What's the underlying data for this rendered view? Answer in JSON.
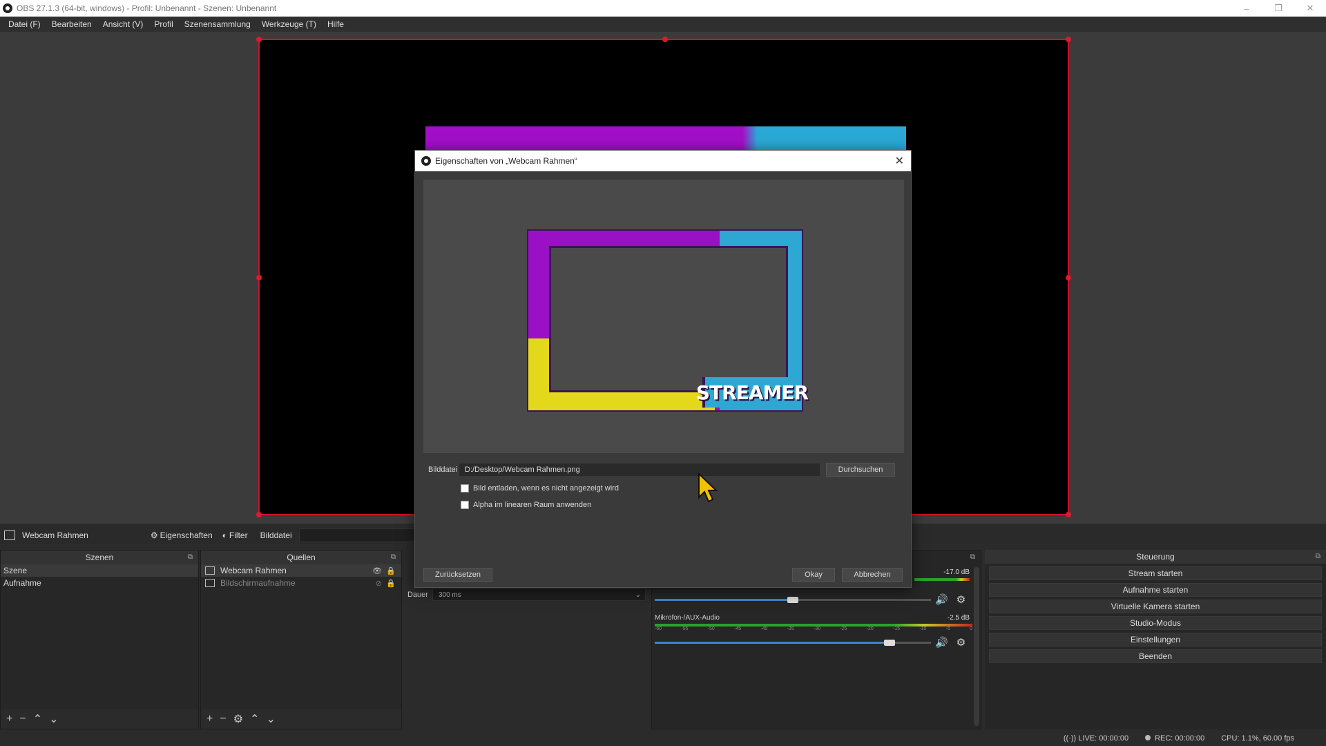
{
  "window": {
    "title": "OBS 27.1.3 (64-bit, windows) - Profil: Unbenannt - Szenen: Unbenannt",
    "controls": [
      "–",
      "❐",
      "✕"
    ]
  },
  "menu": [
    "Datei (F)",
    "Bearbeiten",
    "Ansicht (V)",
    "Profil",
    "Szenensammlung",
    "Werkzeuge (T)",
    "Hilfe"
  ],
  "source_bar": {
    "selected_source": "Webcam Rahmen",
    "properties_label": "Eigenschaften",
    "filter_label": "Filter",
    "image_file_label": "Bilddatei"
  },
  "scenes": {
    "title": "Szenen",
    "items": [
      "Szene",
      "Aufnahme"
    ],
    "selected_index": 0
  },
  "sources": {
    "title": "Quellen",
    "items": [
      {
        "name": "Webcam Rahmen",
        "visible": true
      },
      {
        "name": "Bildschirmaufnahme",
        "visible": false
      }
    ]
  },
  "transition": {
    "duration_label": "Dauer",
    "duration_value": "300 ms"
  },
  "mixer": {
    "channels": [
      {
        "name": "",
        "db": "-17.0 dB",
        "volume_fraction": 0.5
      },
      {
        "name": "Mikrofon-/AUX-Audio",
        "db": "-2.5 dB",
        "volume_fraction": 0.85
      }
    ],
    "ticks": [
      "-60",
      "-55",
      "-50",
      "-45",
      "-40",
      "-35",
      "-30",
      "-25",
      "-20",
      "-15",
      "-10",
      "-5",
      "0"
    ]
  },
  "controls": {
    "title": "Steuerung",
    "buttons": [
      "Stream starten",
      "Aufnahme starten",
      "Virtuelle Kamera starten",
      "Studio-Modus",
      "Einstellungen",
      "Beenden"
    ]
  },
  "status": {
    "live": "LIVE: 00:00:00",
    "rec": "REC: 00:00:00",
    "cpu": "CPU: 1.1%, 60.00 fps"
  },
  "dialog": {
    "title": "Eigenschaften von „Webcam Rahmen“",
    "preview_text": "STREAMER",
    "file_label": "Bilddatei",
    "file_value": "D:/Desktop/Webcam Rahmen.png",
    "browse_label": "Durchsuchen",
    "checkbox_unload": "Bild entladen, wenn es nicht angezeigt wird",
    "checkbox_alpha": "Alpha im linearen Raum anwenden",
    "reset_label": "Zurücksetzen",
    "ok_label": "Okay",
    "cancel_label": "Abbrechen"
  },
  "colors": {
    "selection_red": "#d0102a",
    "frame_purple": "#9a10c4",
    "frame_blue": "#2ea7d2",
    "frame_yellow": "#e3d81c"
  }
}
